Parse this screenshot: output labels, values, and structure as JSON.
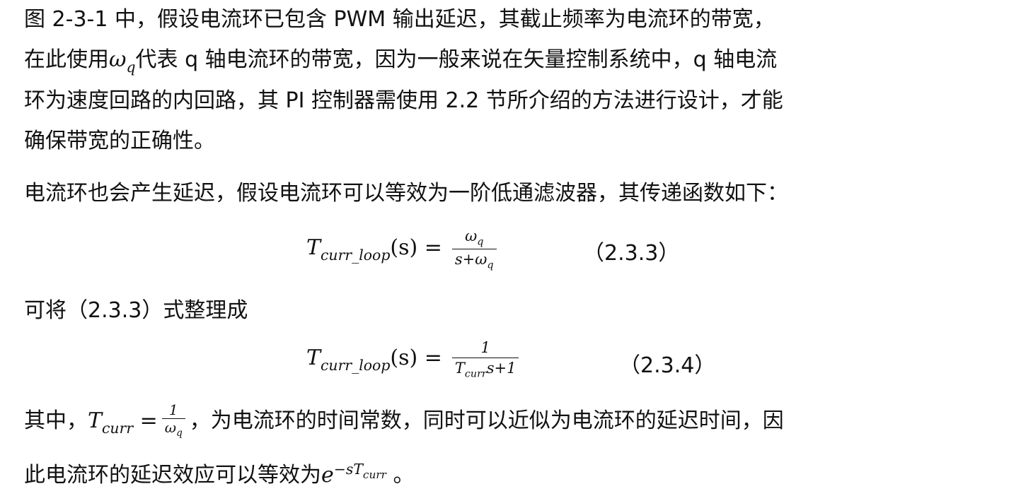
{
  "para1": {
    "line1": "图 2-3-1 中，假设电流环已包含 PWM 输出延迟，其截止频率为电流环的带宽，",
    "line2_a": "在此使用",
    "line2_b": "代表 q 轴电流环的带宽，因为一般来说在矢量控制系统中，q 轴电流",
    "line3": "环为速度回路的内回路，其 PI 控制器需使用 2.2 节所介绍的方法进行设计，才能",
    "line4": "确保带宽的正确性。"
  },
  "para2": {
    "line1": "电流环也会产生延迟，假设电流环可以等效为一阶低通滤波器，其传递函数如下："
  },
  "eq1": {
    "lhs_T": "T",
    "lhs_sub": "curr_loop",
    "lhs_arg": "(s) =",
    "num": "ω",
    "num_sub": "q",
    "den": "s+ω",
    "den_sub": "q",
    "number": "（2.3.3）"
  },
  "para3": {
    "line1": "可将（2.3.3）式整理成"
  },
  "eq2": {
    "lhs_T": "T",
    "lhs_sub": "curr_loop",
    "lhs_arg": "(s) =",
    "num": "1",
    "den_T": "T",
    "den_sub": "curr",
    "den_rest": "s+1",
    "number": "（2.3.4）"
  },
  "para4": {
    "line1_a": "其中，",
    "tcurr_T": "T",
    "tcurr_sub": "curr",
    "tcurr_eq": " =",
    "tcurr_num": "1",
    "tcurr_den": "ω",
    "tcurr_den_sub": "q",
    "line1_b": "，为电流环的时间常数，同时可以近似为电流环的延迟时间，因",
    "line2_a": "此电流环的延迟效应可以等效为",
    "exp_base": "e",
    "exp_sup": "−sT",
    "exp_sup_sub": "curr",
    "line2_b": " 。"
  },
  "symbols": {
    "omega": "ω",
    "omega_sub": "q"
  }
}
